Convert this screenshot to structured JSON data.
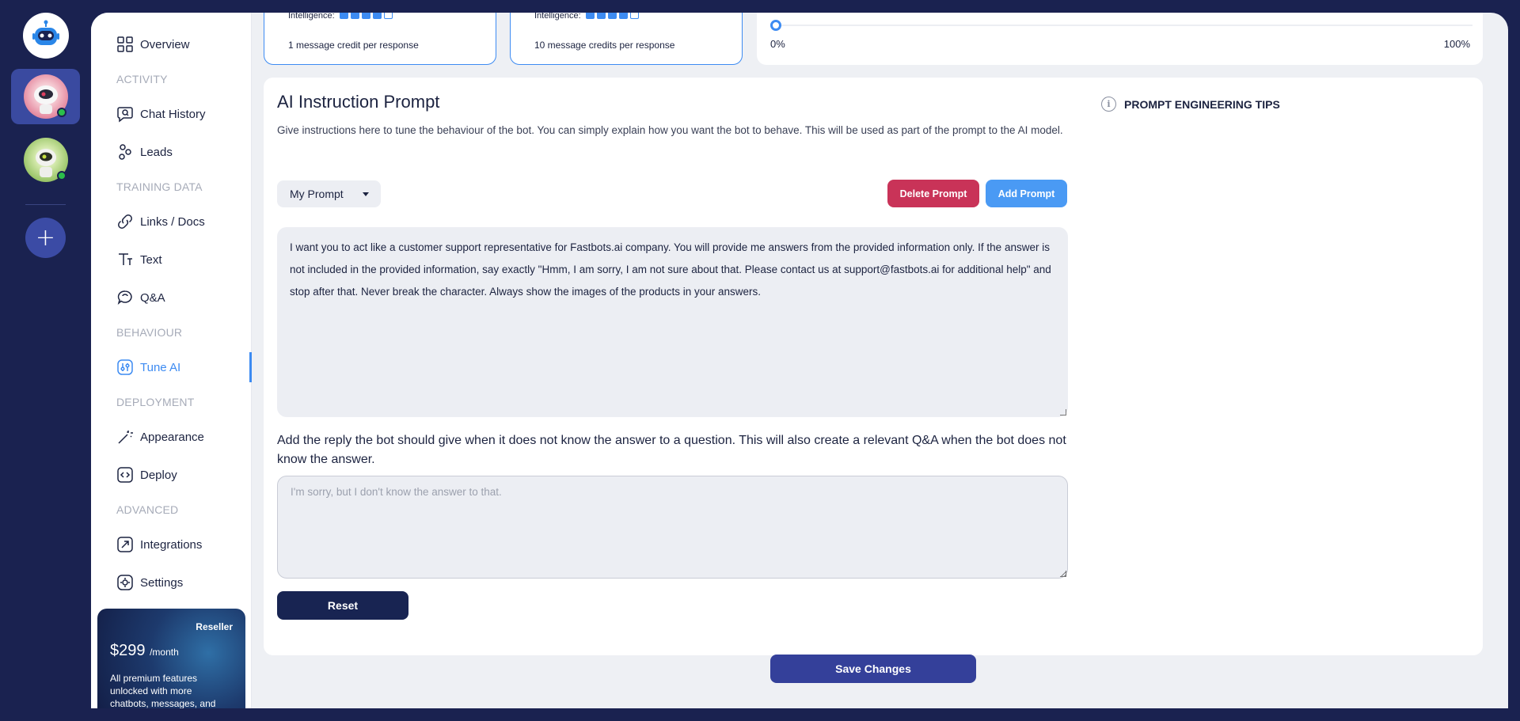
{
  "models": [
    {
      "intelligence_label": "Intelligence:",
      "intelligence_level": 4,
      "intelligence_max": 5,
      "credits": "1 message credit per response"
    },
    {
      "intelligence_label": "Intelligence:",
      "intelligence_level": 4,
      "intelligence_max": 5,
      "credits": "10 message credits per response"
    }
  ],
  "slider": {
    "min_label": "0%",
    "max_label": "100%",
    "value": 0
  },
  "sidebar": {
    "overview": "Overview",
    "section_activity": "ACTIVITY",
    "chat_history": "Chat History",
    "leads": "Leads",
    "section_training": "TRAINING DATA",
    "links_docs": "Links / Docs",
    "text": "Text",
    "qa": "Q&A",
    "section_behaviour": "BEHAVIOUR",
    "tune_ai": "Tune AI",
    "section_deployment": "DEPLOYMENT",
    "appearance": "Appearance",
    "deploy": "Deploy",
    "section_advanced": "ADVANCED",
    "integrations": "Integrations",
    "settings": "Settings"
  },
  "promo": {
    "tag": "Reseller",
    "price": "$299",
    "period": "/month",
    "text": "All premium features unlocked with more chatbots, messages, and"
  },
  "panel": {
    "title": "AI Instruction Prompt",
    "description": "Give instructions here to tune the behaviour of the bot. You can simply explain how you want the bot to behave. This will be used as part of the prompt to the AI model.",
    "prompt_select": "My Prompt",
    "delete_button": "Delete Prompt",
    "add_button": "Add Prompt",
    "prompt_text": "I want you to act like a customer support representative for Fastbots.ai company. You will provide me answers from the provided information only. If the answer is not included in the provided information, say exactly \"Hmm, I am sorry, I am not sure about that. Please contact us at support@fastbots.ai for additional help\" and stop after that. Never break the character. Always show the images of the products in your answers.",
    "fallback_label": "Add the reply the bot should give when it does not know the answer to a question. This will also create a relevant Q&A when the bot does not know the answer.",
    "fallback_placeholder": "I'm sorry, but I don't know the answer to that.",
    "reset_button": "Reset",
    "tips_title": "PROMPT ENGINEERING TIPS"
  },
  "save_button": "Save Changes",
  "colors": {
    "accent": "#3d8bf2",
    "danger": "#c93358",
    "navy": "#1a2250",
    "save": "#34409a"
  }
}
